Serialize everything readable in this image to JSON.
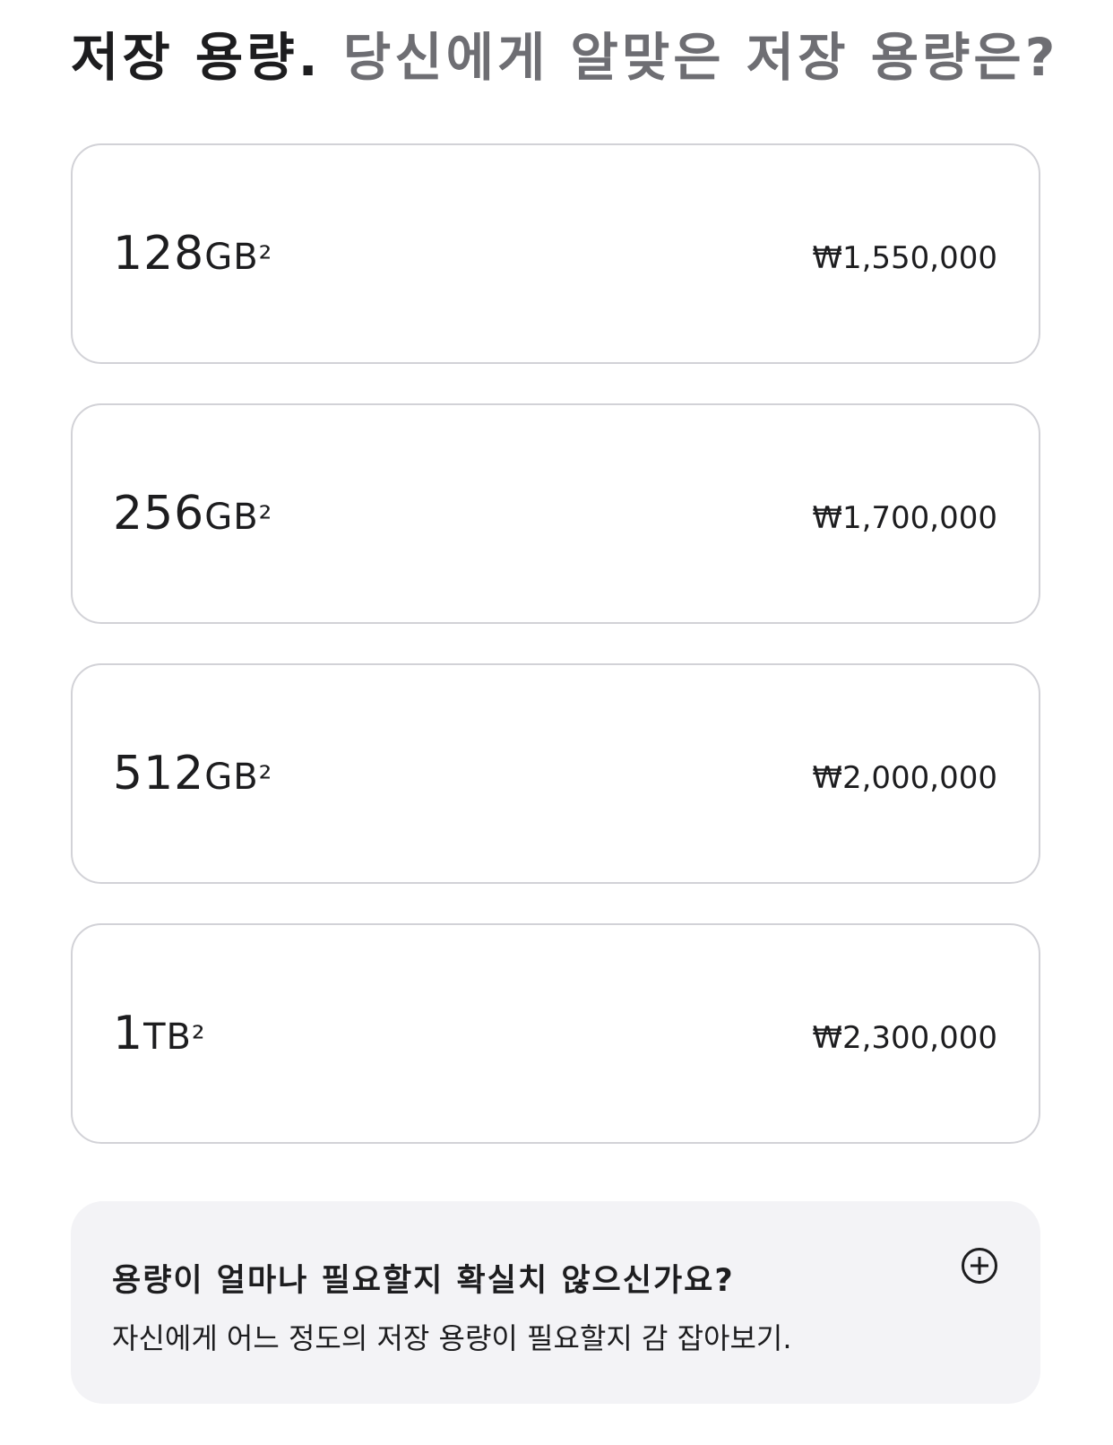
{
  "heading": {
    "lead": "저장 용량.",
    "sub": "당신에게 알맞은 저장 용량은?"
  },
  "options": [
    {
      "number": "128",
      "unit": "GB",
      "footnote": "²",
      "price": "₩1,550,000"
    },
    {
      "number": "256",
      "unit": "GB",
      "footnote": "²",
      "price": "₩1,700,000"
    },
    {
      "number": "512",
      "unit": "GB",
      "footnote": "²",
      "price": "₩2,000,000"
    },
    {
      "number": "1",
      "unit": "TB",
      "footnote": "²",
      "price": "₩2,300,000"
    }
  ],
  "help": {
    "title": "용량이 얼마나 필요할지 확실치 않으신가요?",
    "description": "자신에게 어느 정도의 저장 용량이 필요할지 감 잡아보기.",
    "toggle_icon": "plus-circle-icon"
  }
}
